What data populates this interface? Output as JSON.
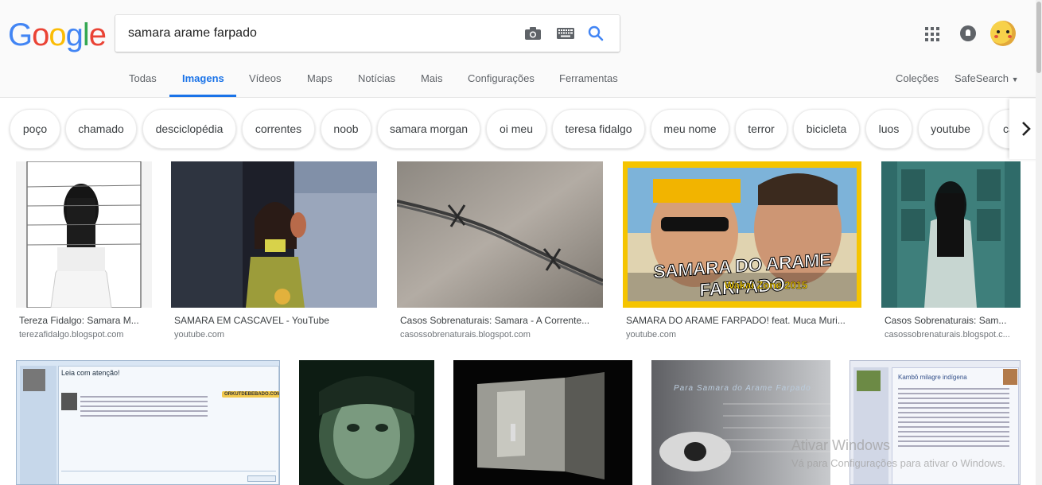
{
  "logo": {
    "letters": [
      "G",
      "o",
      "o",
      "g",
      "l",
      "e"
    ],
    "colors": [
      "#4285F4",
      "#EA4335",
      "#FBBC05",
      "#4285F4",
      "#34A853",
      "#EA4335"
    ]
  },
  "search": {
    "query": "samara arame farpado",
    "icons": [
      "camera-icon",
      "keyboard-icon",
      "search-icon"
    ]
  },
  "header_right": {
    "icons": [
      "apps-icon",
      "notifications-icon",
      "avatar"
    ]
  },
  "tabs": {
    "items": [
      {
        "label": "Todas"
      },
      {
        "label": "Imagens",
        "active": true
      },
      {
        "label": "Vídeos"
      },
      {
        "label": "Maps"
      },
      {
        "label": "Notícias"
      },
      {
        "label": "Mais"
      },
      {
        "label": "Configurações"
      },
      {
        "label": "Ferramentas"
      }
    ],
    "right": {
      "collections": "Coleções",
      "safesearch": "SafeSearch"
    }
  },
  "chips": [
    "poço",
    "chamado",
    "desciclopédia",
    "correntes",
    "noob",
    "samara morgan",
    "oi meu",
    "teresa fidalgo",
    "meu nome",
    "terror",
    "bicicleta",
    "luos",
    "youtube",
    "ca"
  ],
  "results_row1": [
    {
      "caption": "Tereza Fidalgo: Samara M...",
      "domain": "terezafidalgo.blogspot.com"
    },
    {
      "caption": "SAMARA EM CASCAVEL - YouTube",
      "domain": "youtube.com"
    },
    {
      "caption": "Casos Sobrenaturais: Samara - A Corrente...",
      "domain": "casossobrenaturais.blogspot.com"
    },
    {
      "caption": "SAMARA DO ARAME FARPADO! feat. Muca Muri...",
      "domain": "youtube.com",
      "thumb_text": "SAMARA DO ARAME FARPADO",
      "thumb_sub": "Wakai Zone 2015"
    },
    {
      "caption": "Casos Sobrenaturais: Sam...",
      "domain": "casossobrenaturais.blogspot.c..."
    }
  ],
  "results_row2": [
    {
      "thumb_text": "Leia com atenção!",
      "thumb_logo": "ORKUTDEBEBADO.COM"
    },
    {},
    {},
    {
      "thumb_text": "Para Samara do Arame Farpado"
    },
    {
      "thumb_text": "Kambô milagre indígena"
    }
  ],
  "watermark": {
    "title": "Ativar Windows",
    "subtitle": "Vá para Configurações para ativar o Windows."
  }
}
